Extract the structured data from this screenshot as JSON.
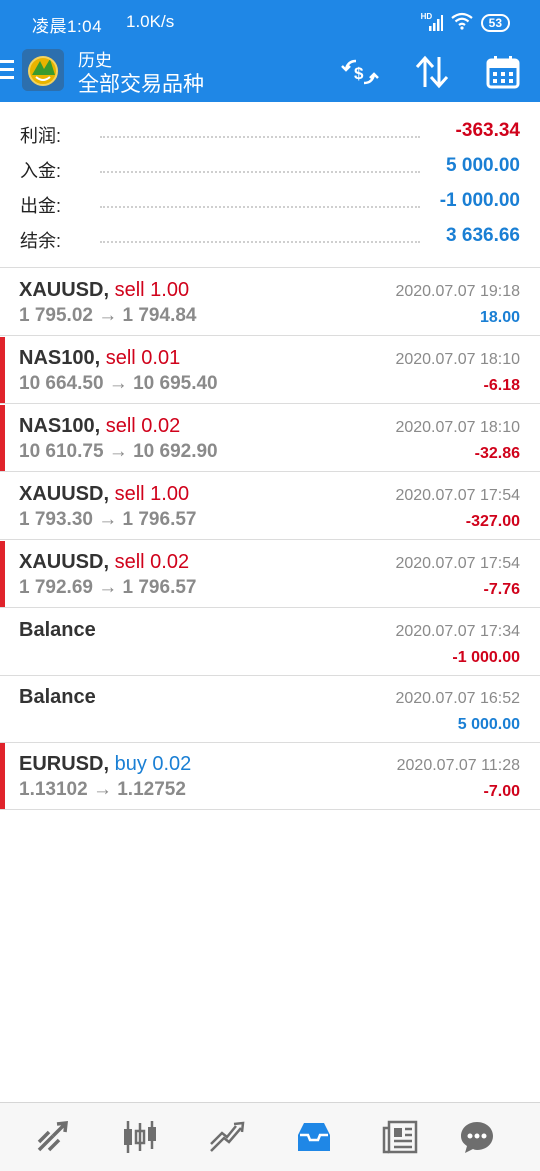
{
  "status": {
    "time": "凌晨1:04",
    "speed": "1.0K/s",
    "network": "HD",
    "battery": "53"
  },
  "header": {
    "title": "历史",
    "subtitle": "全部交易品种"
  },
  "colors": {
    "accent": "#1f87e6",
    "negative": "#d0021b",
    "positive": "#1a7fd4",
    "sell": "#d0021b",
    "buy": "#1a7fd4"
  },
  "summary": [
    {
      "label": "利润:",
      "value": "-363.34",
      "sign": "negative"
    },
    {
      "label": "入金:",
      "value": "5 000.00",
      "sign": "positive"
    },
    {
      "label": "出金:",
      "value": "-1 000.00",
      "sign": "positive"
    },
    {
      "label": "结余:",
      "value": "3 636.66",
      "sign": "positive"
    }
  ],
  "deals": [
    {
      "symbol": "XAUUSD",
      "side": "sell 1.00",
      "side_type": "sell",
      "prices": "1 795.02 → 1 794.84",
      "time": "2020.07.07 19:18",
      "profit": "18.00",
      "profit_sign": "positive",
      "marked": false
    },
    {
      "symbol": "NAS100",
      "side": "sell 0.01",
      "side_type": "sell",
      "prices": "10 664.50 → 10 695.40",
      "time": "2020.07.07 18:10",
      "profit": "-6.18",
      "profit_sign": "negative",
      "marked": true
    },
    {
      "symbol": "NAS100",
      "side": "sell 0.02",
      "side_type": "sell",
      "prices": "10 610.75 → 10 692.90",
      "time": "2020.07.07 18:10",
      "profit": "-32.86",
      "profit_sign": "negative",
      "marked": true
    },
    {
      "symbol": "XAUUSD",
      "side": "sell 1.00",
      "side_type": "sell",
      "prices": "1 793.30 → 1 796.57",
      "time": "2020.07.07 17:54",
      "profit": "-327.00",
      "profit_sign": "negative",
      "marked": false
    },
    {
      "symbol": "XAUUSD",
      "side": "sell 0.02",
      "side_type": "sell",
      "prices": "1 792.69 → 1 796.57",
      "time": "2020.07.07 17:54",
      "profit": "-7.76",
      "profit_sign": "negative",
      "marked": true
    },
    {
      "symbol": "Balance",
      "side": "",
      "side_type": "",
      "prices": "",
      "time": "2020.07.07 17:34",
      "profit": "-1 000.00",
      "profit_sign": "negative",
      "marked": false
    },
    {
      "symbol": "Balance",
      "side": "",
      "side_type": "",
      "prices": "",
      "time": "2020.07.07 16:52",
      "profit": "5 000.00",
      "profit_sign": "positive",
      "marked": false
    },
    {
      "symbol": "EURUSD",
      "side": "buy 0.02",
      "side_type": "buy",
      "prices": "1.13102 → 1.12752",
      "time": "2020.07.07 11:28",
      "profit": "-7.00",
      "profit_sign": "negative",
      "marked": true
    }
  ],
  "nav": [
    {
      "icon": "quotes-icon",
      "active": false
    },
    {
      "icon": "chart-icon",
      "active": false
    },
    {
      "icon": "trade-icon",
      "active": false
    },
    {
      "icon": "history-icon",
      "active": true
    },
    {
      "icon": "news-icon",
      "active": false
    },
    {
      "icon": "chat-icon",
      "active": false
    }
  ]
}
